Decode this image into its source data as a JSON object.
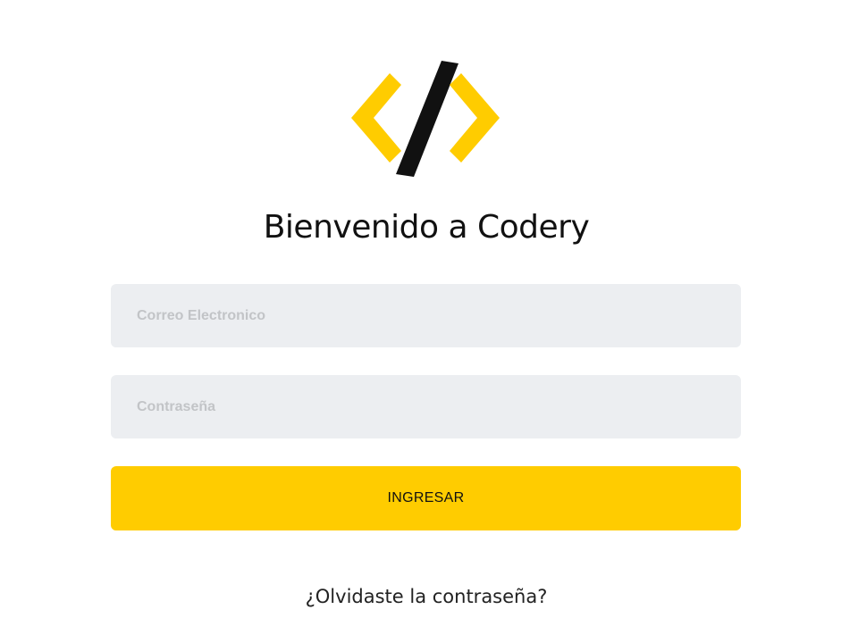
{
  "logo": {
    "icon": "code-brackets-logo",
    "bracket_color": "#ffcc00",
    "slash_color": "#111111"
  },
  "title": "Bienvenido a Codery",
  "form": {
    "email_placeholder": "Correo Electronico",
    "email_value": "",
    "password_placeholder": "Contraseña",
    "password_value": "",
    "submit_label": "INGRESAR",
    "field_bg_color": "#eceef1",
    "submit_color": "#ffcc00"
  },
  "forgot_password_label": "¿Olvidaste la contraseña?"
}
